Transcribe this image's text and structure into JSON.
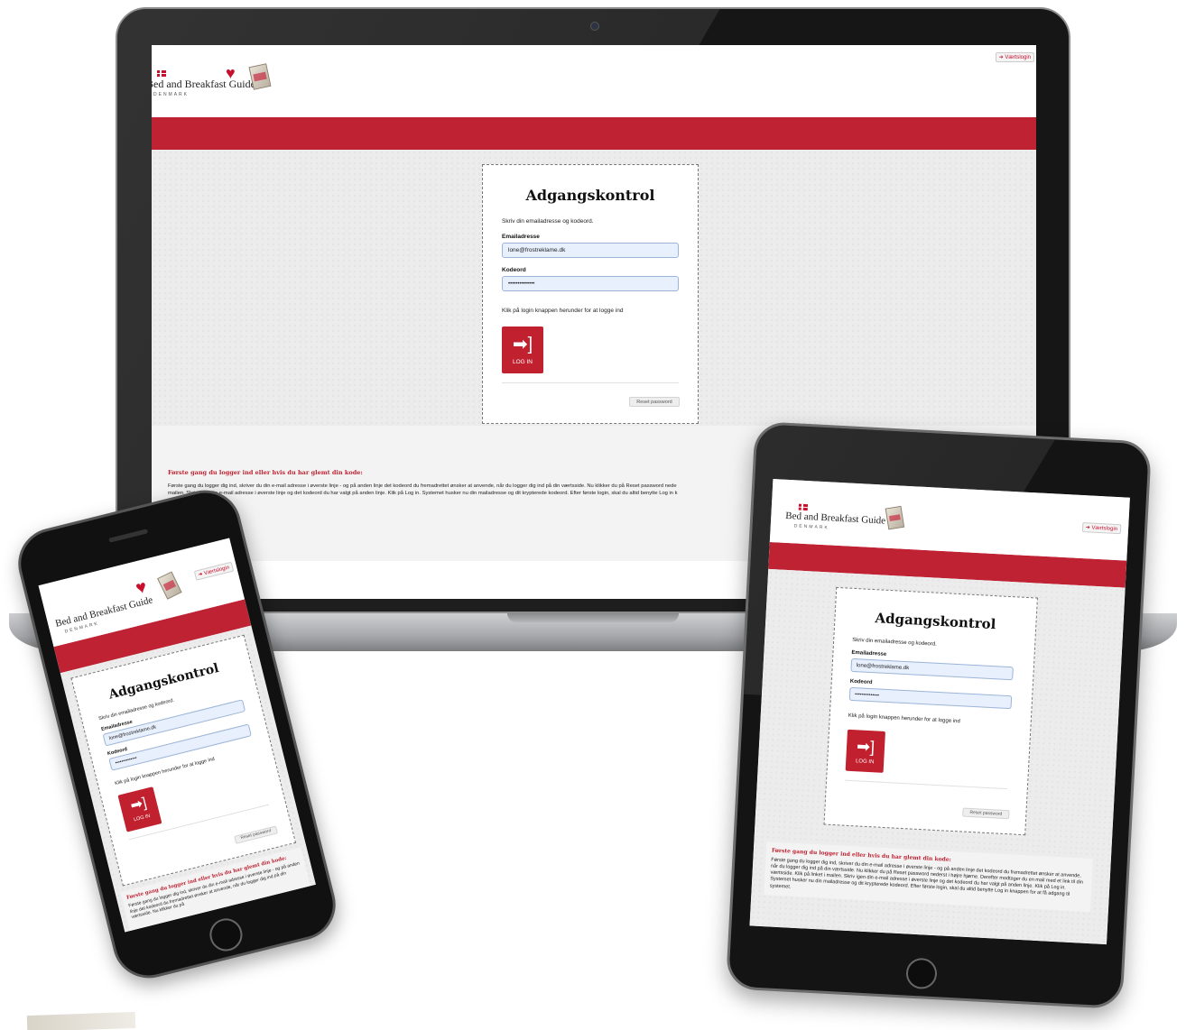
{
  "site": {
    "brand": "Bed and Breakfast Guide",
    "brand_sub": "DENMARK",
    "host_login": "Værtslogin",
    "login": {
      "title": "Adgangskontrol",
      "intro": "Skriv din emailadresse og kodeord.",
      "email_label": "Emailadresse",
      "email_value": "lone@frostreklame.dk",
      "password_label": "Kodeord",
      "password_value": "••••••••••••••",
      "instruction": "Klik på login knappen herunder for at logge ind",
      "login_button": "LOG IN",
      "reset_button": "Reset password"
    },
    "info": {
      "title": "Første gang du logger ind eller hvis du har glemt din kode:",
      "laptop_line1": "Første gang du logger dig ind, skriver du din e-mail adresse i øverste linje - og på anden linje det kodeord du fremadrettet ønsker at anvende, når du logger dig ind på din værtsside. Nu klikker du på Reset password nede",
      "laptop_line2": "mailen. Skriv igen din e-mail adresse i øverste linje og det kodeord du har valgt på anden linje. Klik på Log in. Systemet husker nu din mailadresse og dit krypterede kodeord. Efter første login, skal du altid benytte Log in k",
      "tablet_text": "Første gang du logger dig ind, skriver du din e-mail adresse i øverste linje - og på anden linje det kodeord du fremadrettet ønsker at anvende, når du logger dig ind på din værtsside. Nu klikker du på Reset password nederst i højre hjørne. Derefter modtager du en mail med et link til din værtsside. Klik på linket i mailen. Skriv igen din e-mail adresse i øverste linje og det kodeord du har valgt på anden linje. Klik på Log in. Systemet husker nu din mailadresse og dit krypterede kodeord. Efter første login, skal du altid benytte Log in knappen for at få adgang til systemet.",
      "phone_text": "Første gang du logger dig ind, skriver du din e-mail adresse i øverste linje - og på anden linje det kodeord du fremadrettet ønsker at anvende, når du logger dig ind på din værtsside. Nu klikker du på"
    }
  },
  "colors": {
    "brand_red": "#bf2232",
    "button_red": "#c1202f",
    "field_blue": "#e8f0fe"
  },
  "icons": {
    "login": "sign-in-icon",
    "heart": "heart-icon",
    "flag": "danish-flag-icon"
  }
}
